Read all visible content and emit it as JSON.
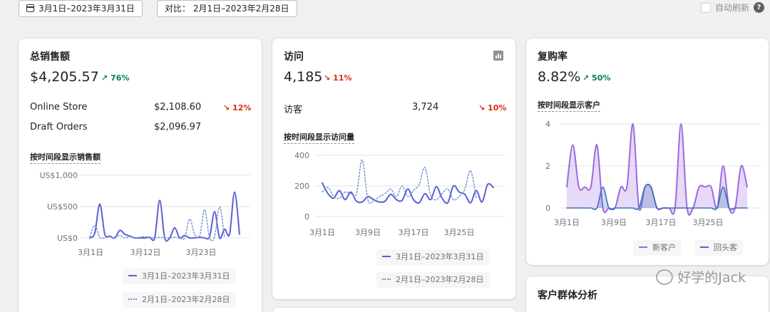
{
  "toolbar": {
    "date_range": "3月1日–2023年3月31日",
    "compare": "对比：  2月1日–2023年2月28日",
    "auto_refresh": "自动刷新",
    "help": "?"
  },
  "colors": {
    "current": "#5c5fd6",
    "previous": "#6b92c9",
    "new_customers": "#9c6ade",
    "returning": "#3d6fbd",
    "up": "#007f5f",
    "down": "#d72c0d"
  },
  "sales": {
    "title": "总销售额",
    "value": "$4,205.57",
    "delta": "76%",
    "rows": [
      {
        "label": "Online Store",
        "value": "$2,108.60",
        "delta": "12%"
      },
      {
        "label": "Draft Orders",
        "value": "$2,096.97"
      }
    ],
    "section": "按时间段显示销售额",
    "legend_current": "3月1日–2023年3月31日",
    "legend_previous": "2月1日–2023年2月28日"
  },
  "visits": {
    "title": "访问",
    "value": "4,185",
    "delta": "11%",
    "row": {
      "label": "访客",
      "value": "3,724",
      "delta": "10%"
    },
    "section": "按时间段显示访问量",
    "legend_current": "3月1日–2023年3月31日",
    "legend_previous": "2月1日–2023年2月28日"
  },
  "repurchase": {
    "title": "复购率",
    "value": "8.82%",
    "delta": "50%",
    "section": "按时间段显示客户",
    "legend_new": "新客户",
    "legend_returning": "回头客"
  },
  "cohort": {
    "title": "客户群体分析"
  },
  "watermark": "好学的Jack",
  "chart_data": [
    {
      "type": "line",
      "yticks": [
        "US$1,000",
        "US$500",
        "US$0"
      ],
      "ylim": [
        0,
        1000
      ],
      "xticks": [
        "3月1日",
        "3月12日",
        "3月23日"
      ],
      "series": [
        {
          "name": "3月1日–2023年3月31日",
          "values": [
            0,
            80,
            540,
            60,
            30,
            0,
            120,
            60,
            30,
            0,
            0,
            0,
            10,
            0,
            600,
            0,
            0,
            160,
            0,
            40,
            0,
            0,
            10,
            0,
            20,
            420,
            0,
            140,
            60,
            730,
            60
          ]
        },
        {
          "name": "2月1日–2023年2月28日",
          "values": [
            20,
            200,
            10,
            0,
            20,
            0,
            40,
            0,
            20,
            0,
            10,
            20,
            0,
            0,
            10,
            0,
            0,
            10,
            0,
            0,
            300,
            60,
            30,
            450,
            0,
            20,
            500,
            0
          ]
        }
      ]
    },
    {
      "type": "line",
      "yticks": [
        "400",
        "200",
        "0"
      ],
      "ylim": [
        0,
        400
      ],
      "xticks": [
        "3月1日",
        "3月9日",
        "3月17日",
        "3月25日"
      ],
      "series": [
        {
          "name": "3月1日–2023年3月31日",
          "values": [
            220,
            150,
            120,
            170,
            110,
            160,
            100,
            95,
            130,
            110,
            95,
            100,
            145,
            110,
            105,
            180,
            110,
            90,
            150,
            110,
            195,
            120,
            90,
            200,
            160,
            145,
            90,
            170,
            95,
            210,
            190
          ]
        },
        {
          "name": "2月1日–2023年2月28日",
          "values": [
            160,
            190,
            130,
            120,
            160,
            150,
            150,
            370,
            110,
            100,
            130,
            150,
            180,
            130,
            200,
            130,
            170,
            210,
            320,
            140,
            110,
            150,
            180,
            110,
            130,
            180,
            300,
            120
          ]
        }
      ]
    },
    {
      "type": "area",
      "yticks": [
        "4",
        "2",
        "0"
      ],
      "ylim": [
        0,
        4
      ],
      "xticks": [
        "3月1日",
        "3月9日",
        "3月17日",
        "3月25日"
      ],
      "series": [
        {
          "name": "新客户",
          "values": [
            1,
            3,
            1,
            1,
            1,
            3,
            0,
            0,
            0,
            1,
            1,
            4,
            0,
            1,
            1,
            0,
            0,
            0,
            0,
            4,
            0,
            0,
            1,
            1,
            1,
            0,
            2,
            0,
            0,
            2,
            1
          ]
        },
        {
          "name": "回头客",
          "values": [
            0,
            0,
            0,
            0,
            0,
            0,
            1,
            0,
            0,
            0,
            0,
            0,
            0,
            1,
            1,
            0,
            0,
            0,
            0,
            0,
            0,
            0,
            0,
            0,
            0,
            0,
            1,
            0,
            0,
            0,
            0
          ]
        }
      ]
    }
  ]
}
